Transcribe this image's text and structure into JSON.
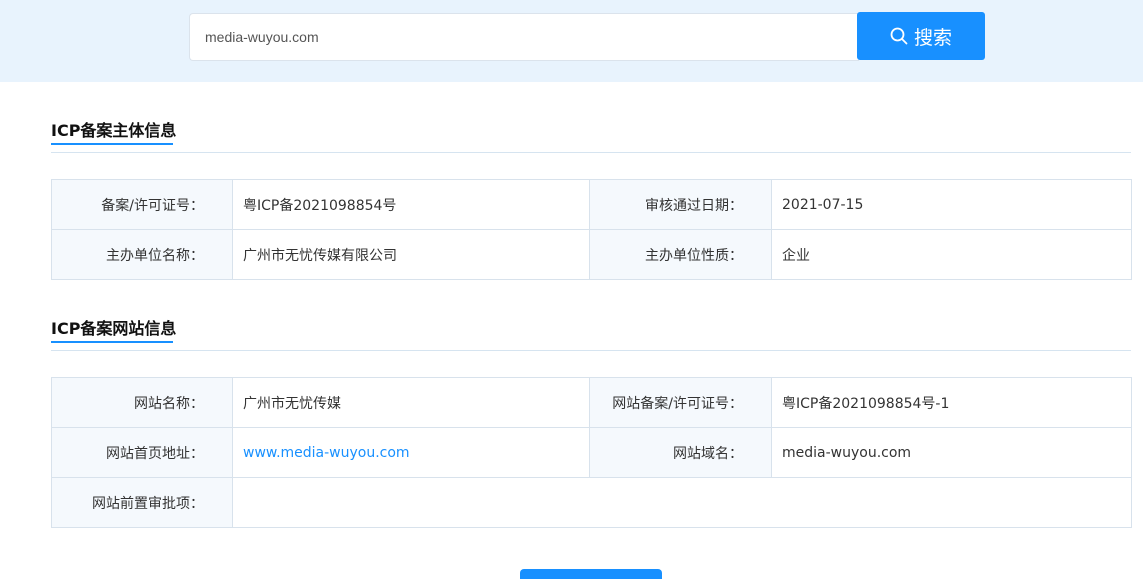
{
  "search": {
    "value": "media-wuyou.com",
    "button_label": "搜索"
  },
  "subject_section": {
    "title": "ICP备案主体信息",
    "rows": [
      {
        "label1": "备案/许可证号：",
        "value1": "粤ICP备2021098854号",
        "label2": "审核通过日期：",
        "value2": "2021-07-15"
      },
      {
        "label1": "主办单位名称：",
        "value1": "广州市无忧传媒有限公司",
        "label2": "主办单位性质：",
        "value2": "企业"
      }
    ]
  },
  "website_section": {
    "title": "ICP备案网站信息",
    "site_name_label": "网站名称：",
    "site_name": "广州市无忧传媒",
    "license_label": "网站备案/许可证号：",
    "license": "粤ICP备2021098854号-1",
    "homepage_label": "网站首页地址：",
    "homepage": "www.media-wuyou.com",
    "domain_label": "网站域名：",
    "domain": "media-wuyou.com",
    "preapproval_label": "网站前置审批项：",
    "preapproval": ""
  },
  "colors": {
    "accent": "#1890ff",
    "band": "#e8f3fd",
    "label_bg": "#f5f9fd",
    "border": "#d8e2ec"
  }
}
